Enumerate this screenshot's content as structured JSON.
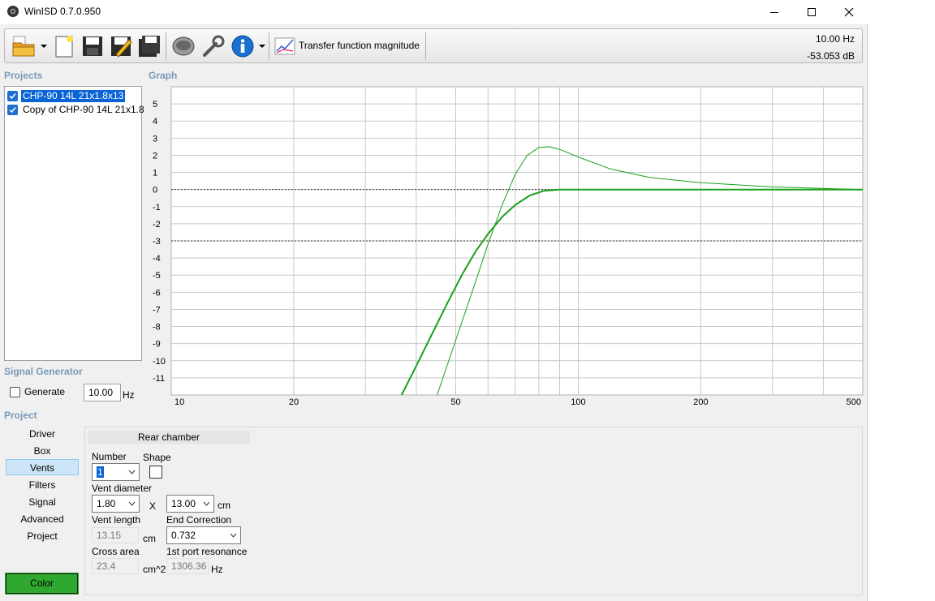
{
  "window": {
    "title": "WinISD 0.7.0.950"
  },
  "toolbar": {
    "transfer_label": "Transfer function magnitude",
    "freq_readout": "10.00 Hz",
    "db_readout": "-53.053 dB"
  },
  "projects": {
    "label": "Projects",
    "items": [
      {
        "name": "CHP-90 14L 21x1.8x13",
        "checked": true,
        "selected": true
      },
      {
        "name": "Copy of CHP-90 14L 21x1.8",
        "checked": true,
        "selected": false
      }
    ]
  },
  "graph": {
    "label": "Graph"
  },
  "signal": {
    "label": "Signal Generator",
    "generate_label": "Generate",
    "freq_value": "10.00",
    "unit": "Hz"
  },
  "project_section": {
    "label": "Project"
  },
  "nav": {
    "items": [
      "Driver",
      "Box",
      "Vents",
      "Filters",
      "Signal",
      "Advanced",
      "Project"
    ],
    "active": "Vents"
  },
  "color_button": {
    "label": "Color",
    "color": "#2fa82f"
  },
  "vents_panel": {
    "header": "Rear chamber",
    "number_label": "Number",
    "number_value": "1",
    "shape_label": "Shape",
    "vent_diameter_label": "Vent diameter",
    "diameter_value": "1.80",
    "x_label": "X",
    "height_value": "13.00",
    "cm_unit": "cm",
    "vent_length_label": "Vent length",
    "vent_length_value": "13.15",
    "end_correction_label": "End Correction",
    "end_correction_value": "0.732",
    "cross_area_label": "Cross area",
    "cross_area_value": "23.4",
    "cm2_unit": "cm^2",
    "port_res_label": "1st port resonance",
    "port_res_value": "1306.36",
    "hz_unit": "Hz"
  },
  "chart_data": {
    "type": "line",
    "xscale": "log",
    "xlim": [
      10,
      500
    ],
    "ylim": [
      -12,
      6
    ],
    "x_ticks": [
      10,
      20,
      50,
      100,
      200,
      500
    ],
    "y_ticks": [
      5,
      4,
      3,
      2,
      1,
      0,
      -1,
      -2,
      -3,
      -4,
      -5,
      -6,
      -7,
      -8,
      -9,
      -10,
      -11
    ],
    "reference_lines": [
      0,
      -3
    ],
    "grid": true,
    "series": [
      {
        "color": "#1aa01a",
        "width": 2,
        "x": [
          36.8,
          40,
          44,
          48,
          52,
          56,
          60,
          65,
          70,
          76,
          82,
          90,
          100,
          115,
          500
        ],
        "y": [
          -12,
          -10.3,
          -8.3,
          -6.5,
          -4.9,
          -3.6,
          -2.6,
          -1.6,
          -0.9,
          -0.35,
          -0.08,
          0,
          0,
          0,
          0
        ]
      },
      {
        "color": "#1aa01a",
        "width": 1,
        "x": [
          45,
          50,
          55,
          60,
          65,
          70,
          75,
          80,
          85,
          90,
          100,
          120,
          150,
          200,
          300,
          500
        ],
        "y": [
          -12,
          -8.8,
          -5.9,
          -3.2,
          -0.9,
          0.9,
          2.0,
          2.45,
          2.5,
          2.35,
          1.9,
          1.2,
          0.7,
          0.4,
          0.15,
          0
        ]
      }
    ]
  }
}
